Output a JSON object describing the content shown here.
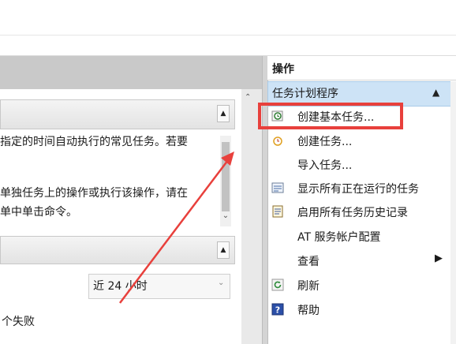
{
  "actions": {
    "title": "操作",
    "group_title": "任务计划程序",
    "group_toggle": "▲",
    "items": [
      {
        "label": "创建基本任务...",
        "icon": "basic-task-icon"
      },
      {
        "label": "创建任务...",
        "icon": "create-task-icon"
      },
      {
        "label": "导入任务...",
        "icon": ""
      },
      {
        "label": "显示所有正在运行的任务",
        "icon": "running-tasks-icon"
      },
      {
        "label": "启用所有任务历史记录",
        "icon": "history-icon"
      },
      {
        "label": "AT 服务帐户配置",
        "icon": ""
      },
      {
        "label": "查看",
        "icon": "",
        "submenu": "▶"
      },
      {
        "label": "刷新",
        "icon": "refresh-icon"
      },
      {
        "label": "帮助",
        "icon": "help-icon"
      }
    ]
  },
  "left": {
    "desc_line1": "指定的时间自动执行的常见任务。若要",
    "desc_line2": "单独任务上的操作或执行该操作，请在",
    "desc_line3": "单中单击命令。",
    "range_value": "近 24 小时",
    "fail_text": "个失败"
  },
  "colors": {
    "highlight": "#e8403c",
    "group_bar": "#cde3f6"
  }
}
